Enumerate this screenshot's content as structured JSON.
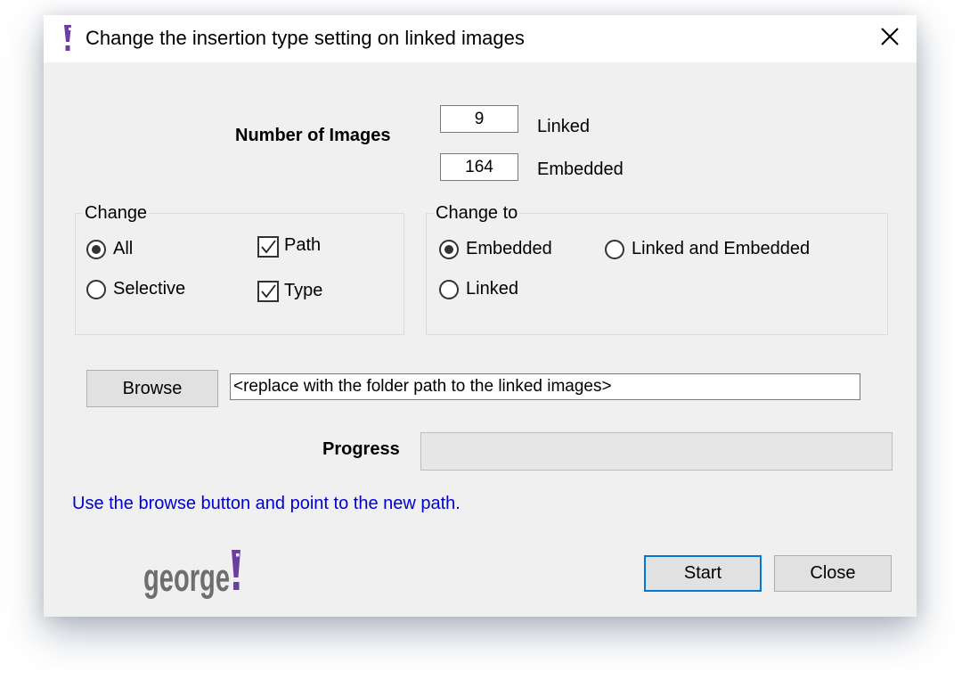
{
  "window": {
    "title": "Change the insertion type setting on linked images",
    "icon": "george-exclamation-icon",
    "close_icon": "close-x-icon"
  },
  "counts": {
    "label": "Number of Images",
    "linked_value": "9",
    "linked_label": "Linked",
    "embedded_value": "164",
    "embedded_label": "Embedded"
  },
  "change_group": {
    "title": "Change",
    "options": [
      {
        "label": "All",
        "checked": true
      },
      {
        "label": "Selective",
        "checked": false
      }
    ],
    "checks": [
      {
        "label": "Path",
        "checked": true
      },
      {
        "label": "Type",
        "checked": true
      }
    ]
  },
  "change_to_group": {
    "title": "Change to",
    "options": [
      {
        "label": "Embedded",
        "checked": true
      },
      {
        "label": "Linked and Embedded",
        "checked": false
      },
      {
        "label": "Linked",
        "checked": false
      }
    ]
  },
  "browse": {
    "button_label": "Browse",
    "path_value": "<replace with the folder path to the linked images>"
  },
  "progress": {
    "label": "Progress",
    "value": 0
  },
  "hint_text": "Use the browse button and point to the new path.",
  "logo": {
    "text": "george",
    "accent_color": "#6b3fa0",
    "text_color": "#6d6e70"
  },
  "buttons": {
    "start_label": "Start",
    "close_label": "Close"
  },
  "colors": {
    "accent": "#0078d7",
    "hint": "#0000cc",
    "window_bg": "#f0f0f0"
  }
}
